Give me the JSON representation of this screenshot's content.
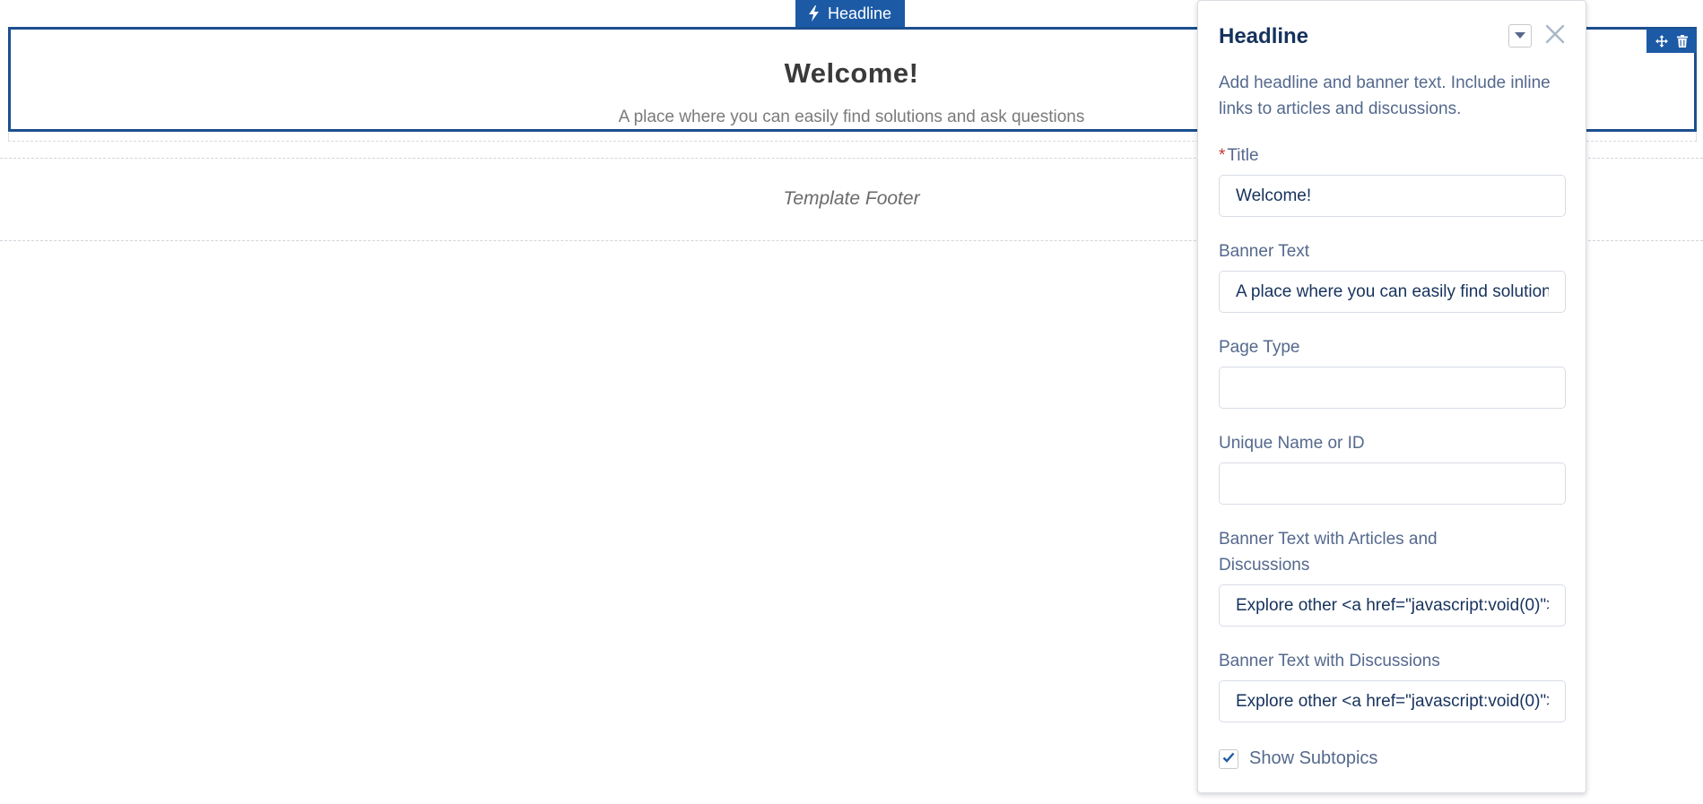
{
  "component_tab": {
    "icon": "lightning-bolt-icon",
    "label": "Headline"
  },
  "canvas": {
    "headline": {
      "title": "Welcome!",
      "banner": "A place where you can easily find solutions and ask questions"
    },
    "handles": {
      "move_icon": "move-arrows-icon",
      "delete_icon": "trash-icon"
    },
    "footer_label": "Template Footer"
  },
  "panel": {
    "title": "Headline",
    "description": "Add headline and banner text. Include inline links to articles and discussions.",
    "fields": {
      "title": {
        "label": "Title",
        "required_mark": "*",
        "value": "Welcome!"
      },
      "banner_text": {
        "label": "Banner Text",
        "value": "A place where you can easily find solutions and ask questions"
      },
      "page_type": {
        "label": "Page Type",
        "value": ""
      },
      "unique_name": {
        "label": "Unique Name or ID",
        "value": ""
      },
      "banner_articles_discussions": {
        "label": "Banner Text with Articles and Discussions",
        "value": "Explore other <a href=\"javascript:void(0)\">articles</a> and <a href=\"javascript:void(0)\">discussions</a> on this topic."
      },
      "banner_discussions": {
        "label": "Banner Text with Discussions",
        "value": "Explore other <a href=\"javascript:void(0)\">discussions</a> on this topic."
      }
    },
    "show_subtopics": {
      "label": "Show Subtopics",
      "checked": true
    }
  },
  "colors": {
    "selection_blue": "#1c5aa6",
    "frame_blue": "#1c4f8f",
    "label_text": "#54698d",
    "title_navy": "#16325c",
    "required_red": "#c23934"
  }
}
